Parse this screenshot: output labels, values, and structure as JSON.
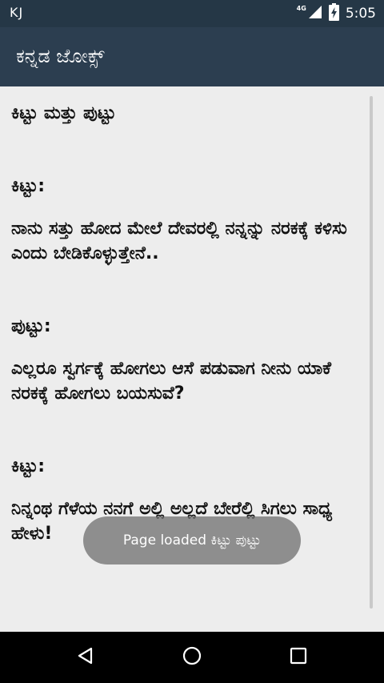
{
  "status_bar": {
    "left_label": "KJ",
    "network_label": "4G",
    "time": "5:05",
    "icons": [
      "signal-icon",
      "battery-charging-icon"
    ]
  },
  "app_bar": {
    "title": "ಕನ್ನಡ ಜೋಕ್ಸ್"
  },
  "article": {
    "title": "ಕಿಟ್ಟು ಮತ್ತು ಪುಟ್ಟು",
    "paragraphs": [
      "ಕಿಟ್ಟು:",
      "ನಾನು ಸತ್ತು ಹೋದ ಮೇಲೆ ದೇವರಲ್ಲಿ ನನ್ನನ್ನು ನರಕಕ್ಕೆ ಕಳಿಸು ಎಂದು ಬೇಡಿಕೊಳ್ಳುತ್ತೇನೆ..",
      "ಪುಟ್ಟು:",
      "ಎಲ್ಲರೂ ಸ್ವರ್ಗಕ್ಕೆ ಹೋಗಲು ಆಸೆ ಪಡುವಾಗ ನೀನು ಯಾಕೆ ನರಕಕ್ಕೆ ಹೋಗಲು ಬಯಸುವೆ?",
      "ಕಿಟ್ಟು:",
      "ನಿನ್ನಂಥ ಗೆಳೆಯ ನನಗೆ ಅಲ್ಲಿ ಅಲ್ಲದೆ ಬೇರೆಲ್ಲಿ ಸಿಗಲು ಸಾಧ್ಯ ಹೇಳು!"
    ]
  },
  "toast": {
    "text": "Page loaded ಕಿಟ್ಟು ಪುಟ್ಟು"
  },
  "nav_bar": {
    "icons": [
      "back-icon",
      "home-icon",
      "recents-icon"
    ]
  },
  "colors": {
    "status_bar_bg": "#253746",
    "app_bar_bg": "#2c3e50",
    "content_bg": "#ededed",
    "nav_bar_bg": "#000000"
  }
}
